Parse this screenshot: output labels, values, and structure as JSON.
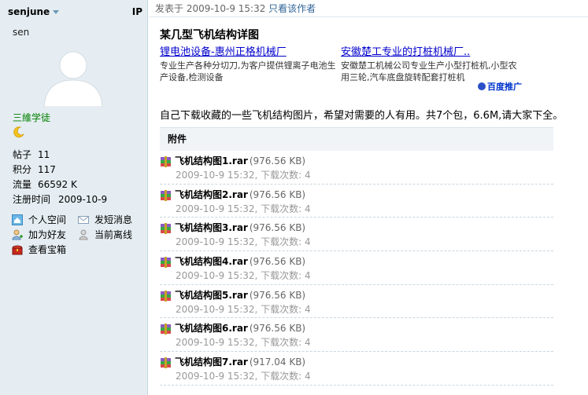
{
  "sidebar": {
    "author": "senjune",
    "ip_label": "IP",
    "nickname": "sen",
    "rank": "三維学徒",
    "stats": [
      {
        "label": "帖子",
        "value": "11"
      },
      {
        "label": "积分",
        "value": "117"
      },
      {
        "label": "流量",
        "value": "66592 K"
      },
      {
        "label": "注册时间",
        "value": "2009-10-9"
      }
    ],
    "actions": [
      {
        "label": "个人空间",
        "icon": "home-icon"
      },
      {
        "label": "发短消息",
        "icon": "envelope-icon"
      },
      {
        "label": "加为好友",
        "icon": "add-friend-icon"
      },
      {
        "label": "当前离线",
        "icon": "offline-user-icon"
      },
      {
        "label": "查看宝箱",
        "icon": "treasure-box-icon"
      }
    ]
  },
  "post": {
    "posted_prefix": "发表于",
    "posted_time": "2009-10-9 15:32",
    "author_only": "只看该作者",
    "title": "某几型飞机结构详图",
    "ads": [
      {
        "title": "锂电池设备-惠州正格机械厂",
        "desc": "专业生产各种分切刀,为客户提供锂离子电池生产设备,检测设备"
      },
      {
        "title": "安徽楚工专业的打桩机械厂..",
        "desc": "安徽楚工机械公司专业生产小型打桩机,小型农用三轮,汽车底盘旋转配套打桩机"
      }
    ],
    "ad_badge": "百度推广",
    "body": "自己下载收藏的一些飞机结构图片，希望对需要的人有用。共7个包，6.6M,请大家下全。",
    "attachments_header": "附件",
    "attachments": [
      {
        "name": "飞机结构图1.rar",
        "size": "(976.56 KB)",
        "info": "2009-10-9 15:32, 下载次数: 4"
      },
      {
        "name": "飞机结构图2.rar",
        "size": "(976.56 KB)",
        "info": "2009-10-9 15:32, 下载次数: 4"
      },
      {
        "name": "飞机结构图3.rar",
        "size": "(976.56 KB)",
        "info": "2009-10-9 15:32, 下载次数: 4"
      },
      {
        "name": "飞机结构图4.rar",
        "size": "(976.56 KB)",
        "info": "2009-10-9 15:32, 下载次数: 4"
      },
      {
        "name": "飞机结构图5.rar",
        "size": "(976.56 KB)",
        "info": "2009-10-9 15:32, 下载次数: 4"
      },
      {
        "name": "飞机结构图6.rar",
        "size": "(976.56 KB)",
        "info": "2009-10-9 15:32, 下载次数: 4"
      },
      {
        "name": "飞机结构图7.rar",
        "size": "(917.04 KB)",
        "info": "2009-10-9 15:32, 下载次数: 4"
      }
    ]
  },
  "colors": {
    "sidebar_bg": "#e5edf2",
    "link": "#336699",
    "rank": "#008000",
    "ad_link": "#0000cc"
  }
}
